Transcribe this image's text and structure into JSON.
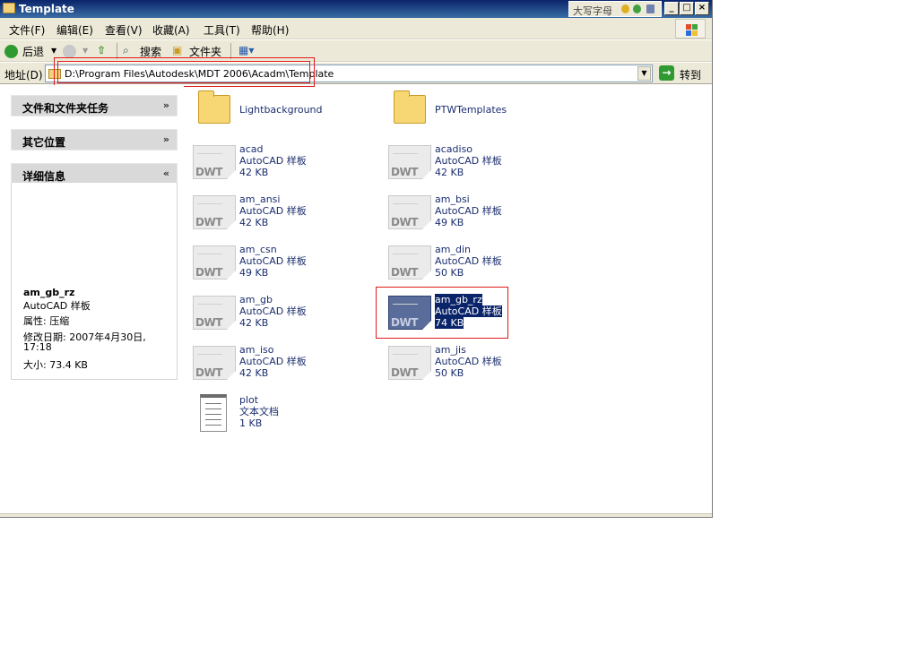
{
  "window": {
    "title": "Template"
  },
  "ime": {
    "label": "大写字母"
  },
  "menu": [
    "文件(F)",
    "编辑(E)",
    "查看(V)",
    "收藏(A)",
    "工具(T)",
    "帮助(H)"
  ],
  "toolbar": {
    "back": "后退",
    "search": "搜索",
    "folders": "文件夹"
  },
  "address": {
    "label": "地址(D)",
    "path": "D:\\Program Files\\Autodesk\\MDT 2006\\Acadm\\Template",
    "go": "转到"
  },
  "tasks": [
    {
      "title": "文件和文件夹任务",
      "chevron": "»"
    },
    {
      "title": "其它位置",
      "chevron": "»"
    },
    {
      "title": "详细信息",
      "chevron": "«"
    }
  ],
  "details": {
    "name": "am_gb_rz",
    "type": "AutoCAD 样板",
    "attr": "属性: 压缩",
    "modified": "修改日期: 2007年4月30日,",
    "modified_time": "17:18",
    "size": "大小: 73.4 KB"
  },
  "items": [
    {
      "kind": "folder",
      "name": "Lightbackground",
      "type": "",
      "size": ""
    },
    {
      "kind": "folder",
      "name": "PTWTemplates",
      "type": "",
      "size": ""
    },
    {
      "kind": "dwt",
      "name": "acad",
      "type": "AutoCAD 样板",
      "size": "42 KB"
    },
    {
      "kind": "dwt",
      "name": "acadiso",
      "type": "AutoCAD 样板",
      "size": "42 KB"
    },
    {
      "kind": "dwt",
      "name": "am_ansi",
      "type": "AutoCAD 样板",
      "size": "42 KB"
    },
    {
      "kind": "dwt",
      "name": "am_bsi",
      "type": "AutoCAD 样板",
      "size": "49 KB"
    },
    {
      "kind": "dwt",
      "name": "am_csn",
      "type": "AutoCAD 样板",
      "size": "49 KB"
    },
    {
      "kind": "dwt",
      "name": "am_din",
      "type": "AutoCAD 样板",
      "size": "50 KB"
    },
    {
      "kind": "dwt",
      "name": "am_gb",
      "type": "AutoCAD 样板",
      "size": "42 KB"
    },
    {
      "kind": "dwt",
      "name": "am_gb_rz",
      "type": "AutoCAD 样板",
      "size": "74 KB",
      "selected": true
    },
    {
      "kind": "dwt",
      "name": "am_iso",
      "type": "AutoCAD 样板",
      "size": "42 KB"
    },
    {
      "kind": "dwt",
      "name": "am_jis",
      "type": "AutoCAD 样板",
      "size": "50 KB"
    },
    {
      "kind": "txt",
      "name": "plot",
      "type": "文本文档",
      "size": "1 KB"
    }
  ],
  "icons": {
    "dwt_label": "DWT"
  },
  "colors": {
    "selection": "#0a246a",
    "highlight_box": "#e21a1a",
    "link_text": "#1b2e6f"
  }
}
